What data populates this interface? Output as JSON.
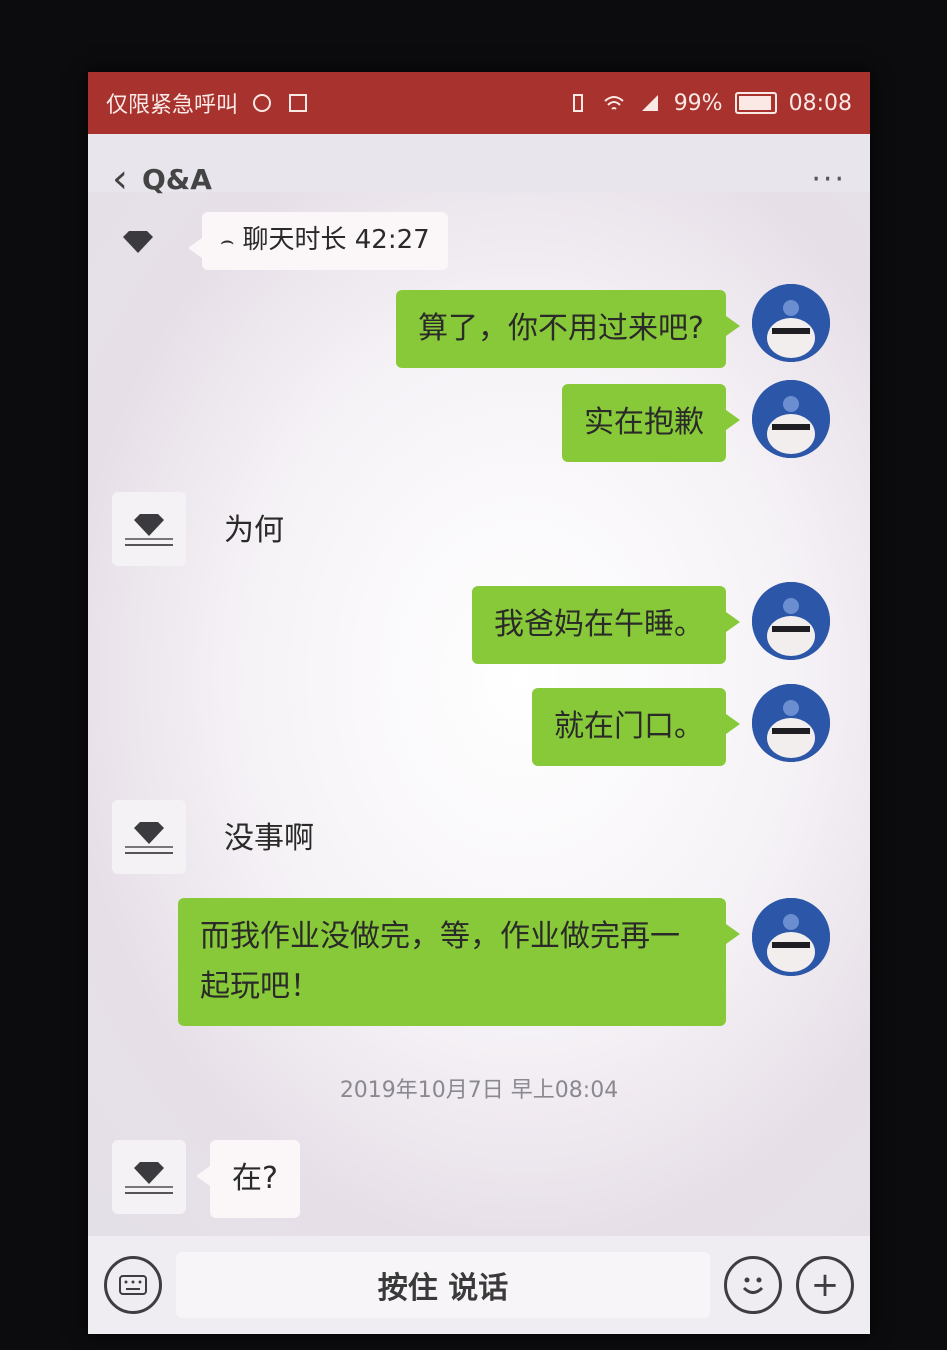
{
  "status_bar": {
    "carrier": "仅限紧急呼叫",
    "battery": "99%",
    "time": "08:08"
  },
  "nav": {
    "back_icon": "chevron-left-icon",
    "title": "Q&A",
    "more_icon": "more-icon"
  },
  "messages": [
    {
      "sender": "them",
      "text": "聊天时长 42:27",
      "icon": "phone-call-icon"
    },
    {
      "sender": "me",
      "text": "算了，你不用过来吧?"
    },
    {
      "sender": "me",
      "text": "实在抱歉"
    },
    {
      "sender": "them",
      "text": "为何"
    },
    {
      "sender": "me",
      "text": "我爸妈在午睡。"
    },
    {
      "sender": "me",
      "text": "就在门口。"
    },
    {
      "sender": "them",
      "text": "没事啊"
    },
    {
      "sender": "me",
      "text": "而我作业没做完，等，作业做完再一起玩吧！"
    },
    {
      "sender": "them",
      "text": "在?"
    }
  ],
  "timestamp": "2019年10月7日 早上08:04",
  "input_bar": {
    "voice_icon": "keyboard-voice-icon",
    "hold_to_talk": "按住 说话",
    "emoji_icon": "emoji-icon",
    "plus_icon": "plus-icon"
  },
  "colors": {
    "status_bar": "#a8322d",
    "my_bubble": "#88c93a",
    "their_bubble": "#fbf7f8"
  }
}
